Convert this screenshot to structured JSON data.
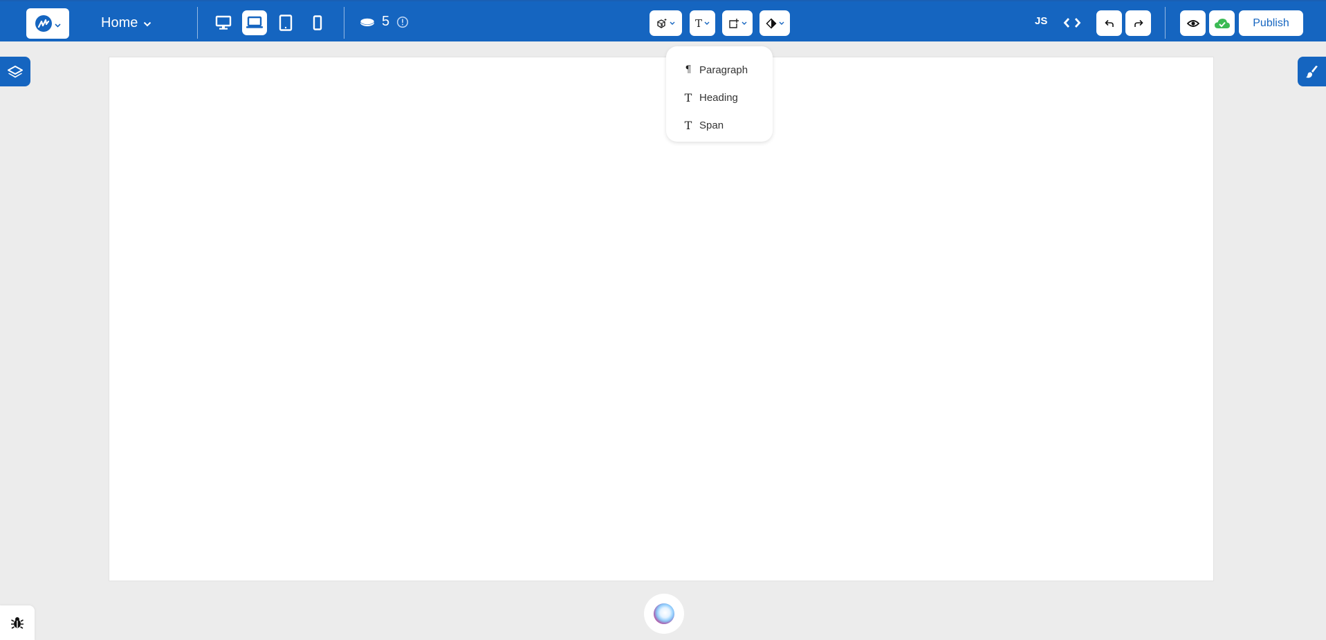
{
  "topbar": {
    "logo": {
      "icon": "app-logo-icon",
      "chevron": "chevron-down-icon"
    },
    "page_selector": {
      "label": "Home",
      "icon": "chevron-down-icon"
    },
    "devices": [
      {
        "name": "desktop",
        "icon": "desktop-icon",
        "active": false
      },
      {
        "name": "laptop",
        "icon": "laptop-icon",
        "active": true
      },
      {
        "name": "tablet",
        "icon": "tablet-icon",
        "active": false
      },
      {
        "name": "mobile",
        "icon": "mobile-icon",
        "active": false
      }
    ],
    "credits": {
      "icon": "coin-icon",
      "count": "5",
      "info_icon": "info-circle-icon"
    },
    "tools": [
      {
        "name": "components",
        "icon": "cube-add-icon"
      },
      {
        "name": "text",
        "icon": "text-icon"
      },
      {
        "name": "add-element",
        "icon": "square-plus-icon"
      },
      {
        "name": "style",
        "icon": "contrast-diamond-icon"
      }
    ],
    "js_label": "JS",
    "code_icon": "code-brackets-icon",
    "undo_icon": "undo-icon",
    "redo_icon": "redo-icon",
    "preview_icon": "eye-icon",
    "saved_icon": "cloud-check-icon",
    "publish_label": "Publish"
  },
  "text_dropdown": {
    "items": [
      {
        "label": "Paragraph",
        "icon": "paragraph-icon",
        "glyph": "¶"
      },
      {
        "label": "Heading",
        "icon": "heading-icon",
        "glyph": "T"
      },
      {
        "label": "Span",
        "icon": "span-icon",
        "glyph": "T"
      }
    ]
  },
  "side": {
    "left_tab_icon": "layers-icon",
    "right_tab_icon": "brush-icon",
    "bug_icon": "bug-icon",
    "ai_icon": "ai-orb-icon"
  },
  "colors": {
    "brand": "#1565c0",
    "background": "#ececec",
    "canvas": "#ffffff",
    "saved_green": "#3cba54"
  }
}
